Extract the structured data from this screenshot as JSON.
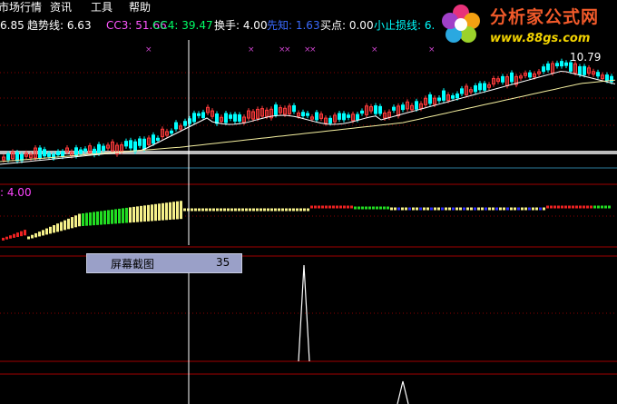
{
  "menu": {
    "item_market": "市场行情",
    "item_info": "资讯",
    "item_tools": "工具",
    "item_help": "帮助"
  },
  "legend": {
    "first_value": "6.85",
    "trend": "趋势线: 6.63",
    "cc3": "CC3: 51.66",
    "cc4": "CC4: 39.47",
    "turnover": "换手: 4.00",
    "pioneer": "先知: 1.63",
    "buy_point": "买点: 0.00",
    "stop_loss": "小止损线: 6."
  },
  "logo": {
    "title": "分析家公式网",
    "url": "www.88gs.com"
  },
  "price_label": "10.79",
  "sub_label": ": 4.00",
  "badge": {
    "label": "屏幕截图",
    "value": "35"
  },
  "colors": {
    "up": "#ff3b3b",
    "down": "#00ffff",
    "ma": "#ffffff",
    "ma2": "#f5f0a0",
    "axis": "#a00000",
    "green": "#22dd22",
    "yellow": "#f5f08a",
    "red": "#ee2222",
    "blue": "#3030ff"
  }
}
